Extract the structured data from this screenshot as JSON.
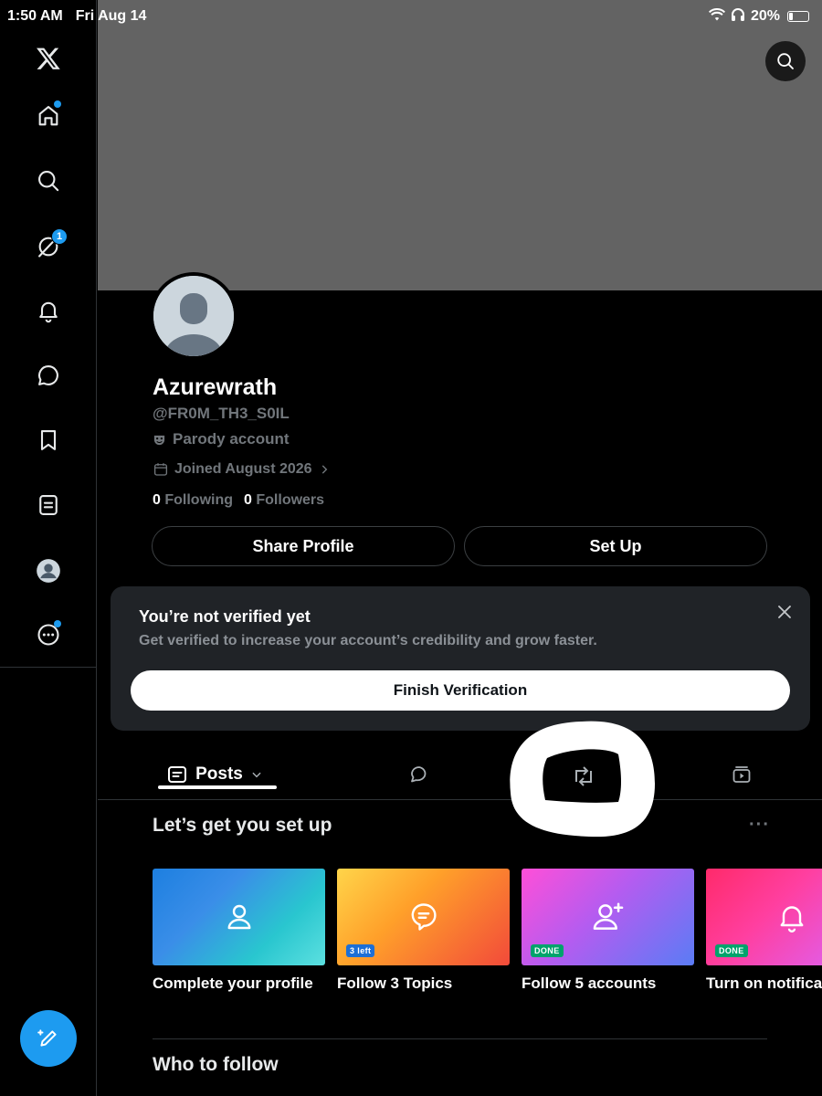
{
  "status_bar": {
    "time": "1:50 AM",
    "date": "Fri Aug 14",
    "battery": "20%",
    "battery_level": 0.2
  },
  "sidebar": {
    "items": [
      {
        "name": "x-logo",
        "icon": "x-logo-icon"
      },
      {
        "name": "home",
        "icon": "home-icon",
        "has_dot": true
      },
      {
        "name": "explore",
        "icon": "search-icon"
      },
      {
        "name": "grok",
        "icon": "grok-icon",
        "badge": "1"
      },
      {
        "name": "notifications",
        "icon": "bell-icon"
      },
      {
        "name": "communities",
        "icon": "chat-bubble-icon"
      },
      {
        "name": "bookmarks",
        "icon": "bookmark-icon"
      },
      {
        "name": "lists",
        "icon": "list-icon"
      },
      {
        "name": "profile",
        "icon": "avatar-icon"
      },
      {
        "name": "more",
        "icon": "more-circle-icon",
        "has_dot": true
      }
    ],
    "compose_icon": "compose-icon"
  },
  "profile": {
    "display_name": "Azurewrath",
    "handle": "@FR0M_TH3_S0IL",
    "parody_label": "Parody account",
    "joined": "Joined August 2026",
    "following_count": "0",
    "following_label": "Following",
    "followers_count": "0",
    "followers_label": "Followers",
    "share_button": "Share Profile",
    "setup_button": "Set Up"
  },
  "verification": {
    "title": "You’re not verified yet",
    "subtitle": "Get verified to increase your account’s credibility and grow faster.",
    "button": "Finish Verification"
  },
  "tabs": {
    "posts_label": "Posts"
  },
  "setup": {
    "title": "Let’s get you set up",
    "more": "···",
    "cards": [
      {
        "label": "Complete your profile",
        "icon": "person-icon"
      },
      {
        "label": "Follow 3 Topics",
        "icon": "topic-icon",
        "badge": "3 left"
      },
      {
        "label": "Follow 5 accounts",
        "icon": "person-add-icon",
        "badge": "DONE"
      },
      {
        "label": "Turn on notifica",
        "icon": "bell-icon",
        "badge": "DONE"
      }
    ]
  },
  "who_to_follow": {
    "title": "Who to follow"
  },
  "colors": {
    "accent": "#1d9bf0",
    "banner": "#636363",
    "card_bg": "#202327",
    "muted_text": "#71767b"
  }
}
